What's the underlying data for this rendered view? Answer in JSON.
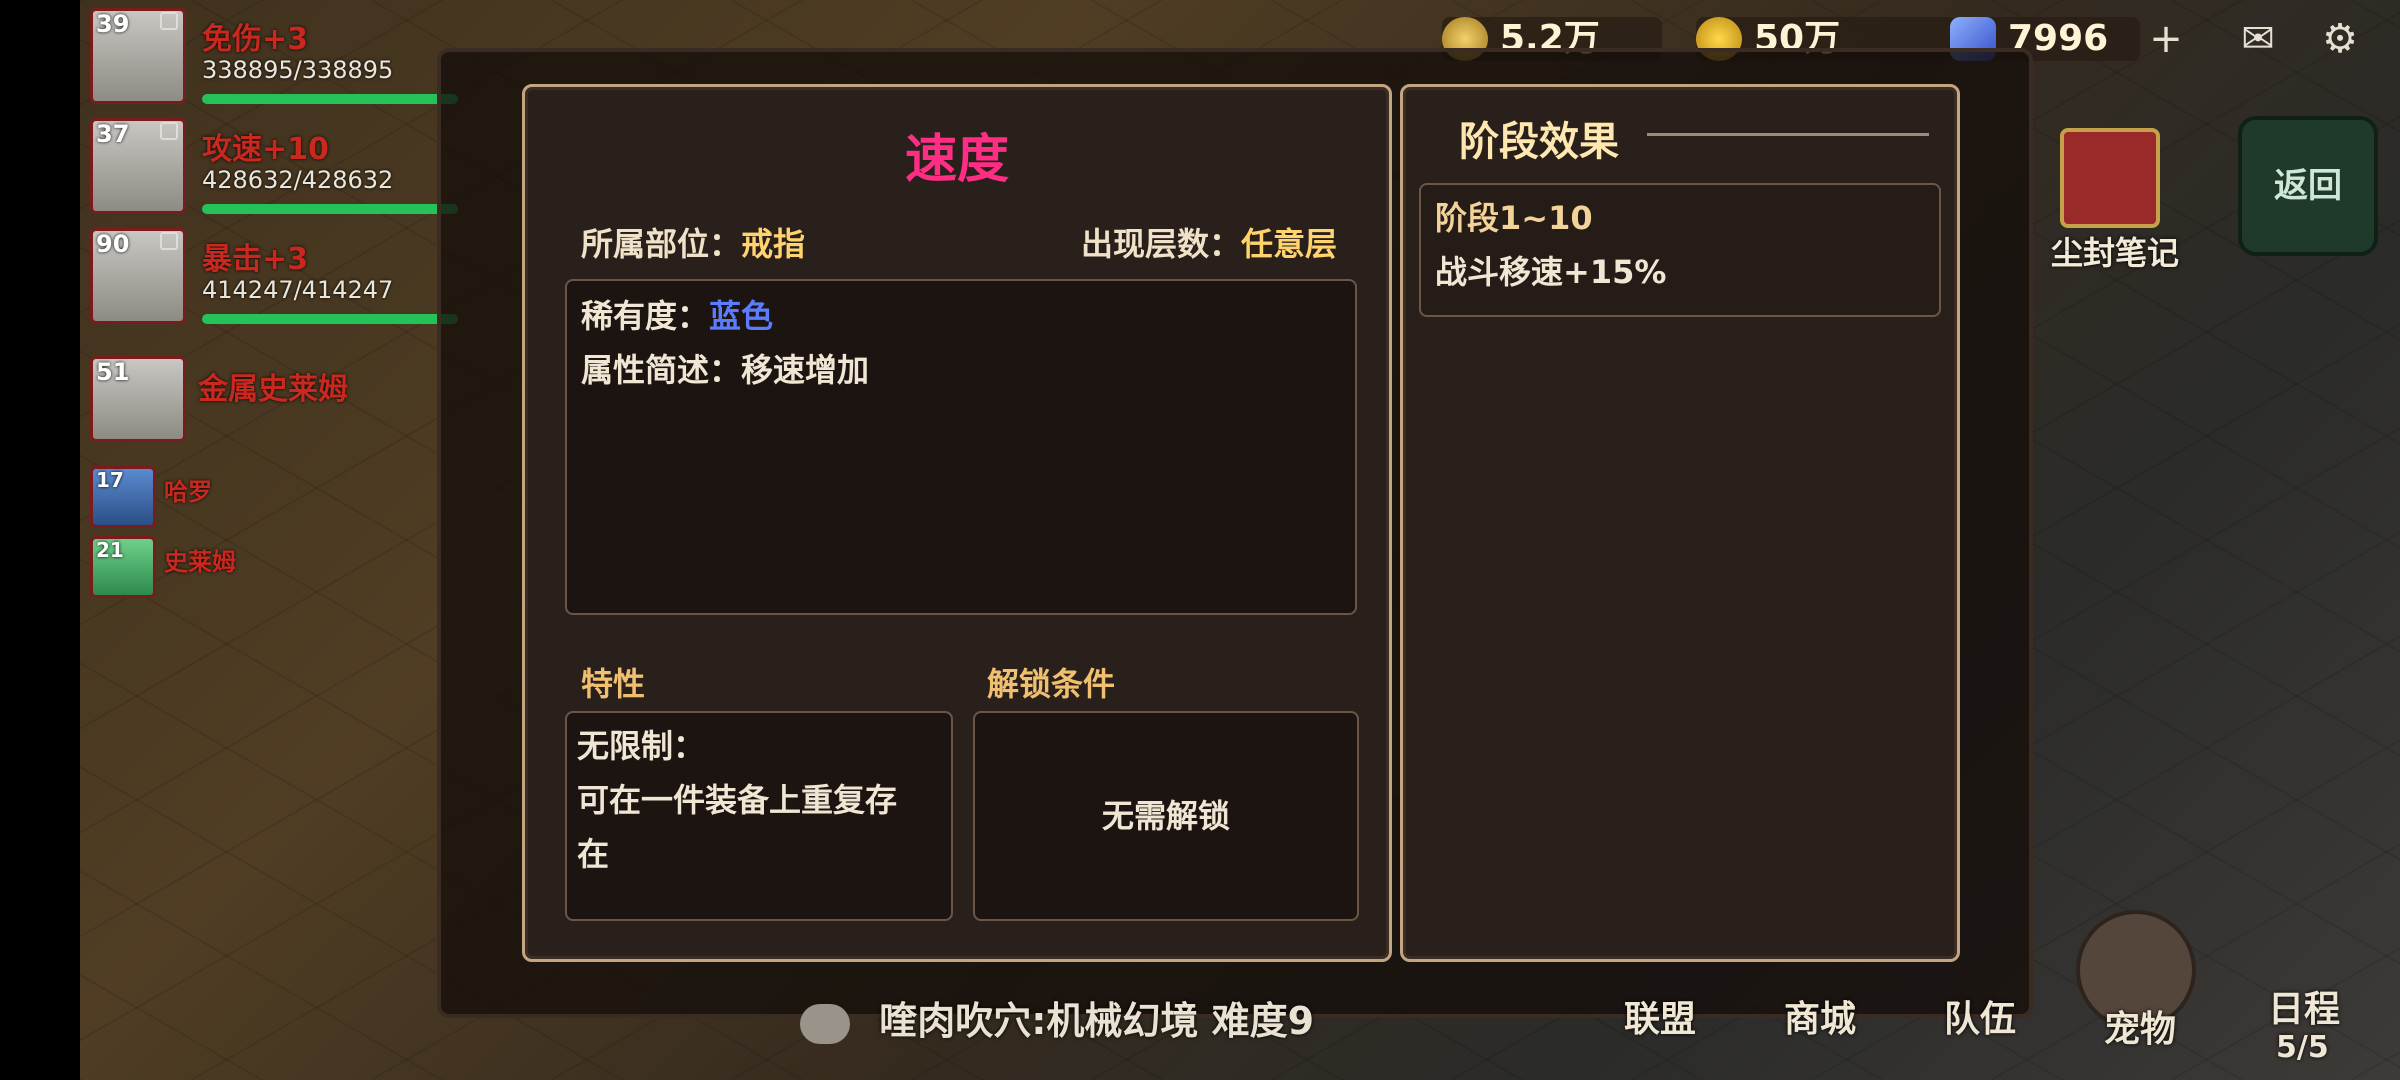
{
  "resources": [
    {
      "value": "5.2万",
      "icon": "wheat-icon",
      "color": "#e0b84a"
    },
    {
      "value": "50万",
      "icon": "gold-coin-icon",
      "color": "#e6b32a"
    },
    {
      "value": "7996",
      "icon": "diamond-icon",
      "color": "#4a6ad8"
    }
  ],
  "hud": {
    "plus": "+",
    "mail_icon": "mail-icon",
    "settings_icon": "gear-icon"
  },
  "party": [
    {
      "level": "39",
      "name": "免伤+3",
      "hp": "338895/338895",
      "hp_fraction": 1.0
    },
    {
      "level": "37",
      "name": "攻速+10",
      "hp": "428632/428632",
      "hp_fraction": 1.0
    },
    {
      "level": "90",
      "name": "暴击+3",
      "hp": "414247/414247",
      "hp_fraction": 1.0
    }
  ],
  "enemies": [
    {
      "level": "51",
      "name": "金属史莱姆"
    },
    {
      "level": "17",
      "name": "哈罗"
    },
    {
      "level": "21",
      "name": "史莱姆"
    }
  ],
  "dialog": {
    "title": "速度",
    "slot_label": "所属部位：",
    "slot_value": "戒指",
    "floor_label": "出现层数：",
    "floor_value": "任意层",
    "rarity_label": "稀有度：",
    "rarity_value": "蓝色",
    "desc_label": "属性简述：",
    "desc_value": "移速增加",
    "trait_title": "特性",
    "trait_line1": "无限制：",
    "trait_line2": "可在一件装备上重复存",
    "trait_line3": "在",
    "unlock_title": "解锁条件",
    "unlock_value": "无需解锁"
  },
  "stage": {
    "title": "阶段效果",
    "range": "阶段1~10",
    "effect": "战斗移速+15%"
  },
  "right": {
    "back": "返回",
    "notebook": "尘封笔记"
  },
  "bottom_nav": [
    "联盟",
    "商城",
    "队伍",
    "宠物",
    "日程"
  ],
  "schedule_count": "5/5",
  "chat_tip": "喹肉吹穴:机械幻境 难度9",
  "colors": {
    "title": "#ff2d84",
    "accent": "#ffd36e",
    "rare_blue": "#5b7cff",
    "border": "#c4a582"
  }
}
